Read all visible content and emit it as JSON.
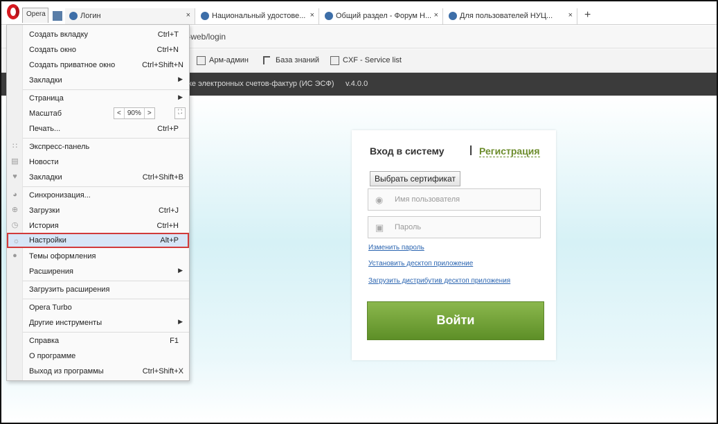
{
  "browser": {
    "opera_label": "Opera",
    "tabs": [
      {
        "label": "Логин",
        "close": "×"
      },
      {
        "label": "Национальный удостове...",
        "close": "×"
      },
      {
        "label": "Общий раздел - Форум Н...",
        "close": "×"
      },
      {
        "label": "Для пользователей НУЦ...",
        "close": "×"
      }
    ],
    "new_tab": "+",
    "url": "f-web/login",
    "bookmarks": [
      "Арм-админ",
      "База знаний",
      "CXF - Service list"
    ]
  },
  "app": {
    "name": "ке электронных счетов-фактур (ИС ЭСФ)",
    "version": "v.4.0.0"
  },
  "login": {
    "title": "Вход в систему",
    "separator": "|",
    "register": "Регистрация",
    "cert_button": "Выбрать сертификат",
    "username_placeholder": "Имя пользователя",
    "password_placeholder": "Пароль",
    "links": [
      "Изменить пароль",
      "Установить десктоп приложение",
      "Загрузить дистрибутив десктоп приложения"
    ],
    "submit": "Войти"
  },
  "menu": {
    "items": [
      {
        "label": "Создать вкладку",
        "shortcut": "Ctrl+T"
      },
      {
        "label": "Создать окно",
        "shortcut": "Ctrl+N"
      },
      {
        "label": "Создать приватное окно",
        "shortcut": "Ctrl+Shift+N"
      },
      {
        "label": "Закладки",
        "shortcut": ""
      },
      {
        "label": "Страница",
        "shortcut": ""
      },
      {
        "label": "Масштаб",
        "shortcut": ""
      },
      {
        "label": "Печать...",
        "shortcut": "Ctrl+P"
      },
      {
        "label": "Экспресс-панель",
        "shortcut": ""
      },
      {
        "label": "Новости",
        "shortcut": ""
      },
      {
        "label": "Закладки",
        "shortcut": "Ctrl+Shift+B"
      },
      {
        "label": "Синхронизация...",
        "shortcut": ""
      },
      {
        "label": "Загрузки",
        "shortcut": "Ctrl+J"
      },
      {
        "label": "История",
        "shortcut": "Ctrl+H"
      },
      {
        "label": "Настройки",
        "shortcut": "Alt+P"
      },
      {
        "label": "Темы оформления",
        "shortcut": ""
      },
      {
        "label": "Расширения",
        "shortcut": ""
      },
      {
        "label": "Загрузить расширения",
        "shortcut": ""
      },
      {
        "label": "Opera Turbo",
        "shortcut": ""
      },
      {
        "label": "Другие инструменты",
        "shortcut": ""
      },
      {
        "label": "Справка",
        "shortcut": "F1"
      },
      {
        "label": "О программе",
        "shortcut": ""
      },
      {
        "label": "Выход из программы",
        "shortcut": "Ctrl+Shift+X"
      }
    ],
    "zoom": {
      "dec": "<",
      "value": "90%",
      "inc": ">",
      "fullscreen": "⛶"
    },
    "highlight_color": "#d13a3a"
  }
}
